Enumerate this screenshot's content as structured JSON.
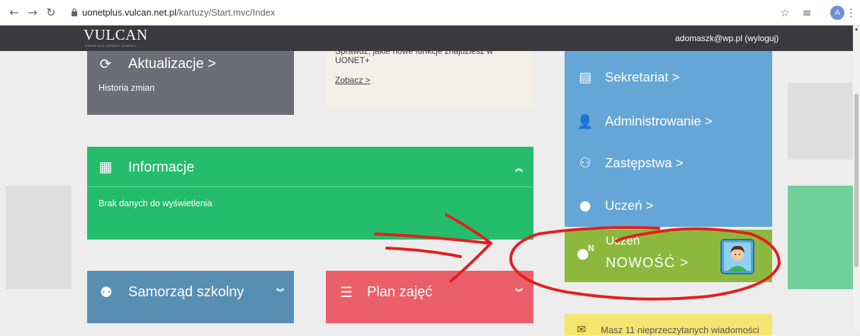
{
  "browser": {
    "url_host": "uonetplus.vulcan.net.pl",
    "url_path": "/kartuzy/Start.mvc/Index",
    "back_icon": "arrow-left-icon",
    "forward_icon": "arrow-right-icon",
    "reload_icon": "reload-icon",
    "profile_initial": "A"
  },
  "header": {
    "logo": "VULCAN",
    "logo_tagline": "RAZEM DLA LEPSZEJ OŚWIATY",
    "user": "adomaszk@wp.pl (wyloguj)"
  },
  "tiles": {
    "aktualizacje": {
      "title": "Aktualizacje >",
      "subtitle": "Historia zmian",
      "icon": "refresh-icon"
    },
    "news": {
      "text": "Sprawdź, jakie nowe funkcje znajdziesz w UONET+",
      "link": "Zobacz >"
    },
    "informacje": {
      "title": "Informacje",
      "body": "Brak danych do wyświetlenia",
      "icon": "newspaper-icon"
    },
    "samorzad": {
      "title": "Samorząd szkolny",
      "icon": "users-icon"
    },
    "plan": {
      "title": "Plan zajęć",
      "icon": "user-list-icon"
    },
    "nowosc": {
      "title_line1": "Uczeń",
      "title_line2": "NOWOŚĆ >",
      "badge": "N"
    },
    "yellow": {
      "text": "Masz 11 nieprzeczytanych wiadomości",
      "count": "11"
    }
  },
  "menu": [
    {
      "label": "Sekretariat >",
      "icon": "server-icon"
    },
    {
      "label": "Administrowanie >",
      "icon": "user-check-icon"
    },
    {
      "label": "Zastępstwa >",
      "icon": "group-icon"
    },
    {
      "label": "Uczeń >",
      "icon": "user-icon"
    }
  ],
  "colors": {
    "appbar": "#3a3a3e",
    "aktualizacje": "#6d6e75",
    "informacje": "#23bd6c",
    "right_menu": "#65a6d6",
    "samorzad": "#578fb3",
    "plan": "#ea5f6a",
    "nowosc": "#8cb93d",
    "annotation": "#e41e1e"
  }
}
